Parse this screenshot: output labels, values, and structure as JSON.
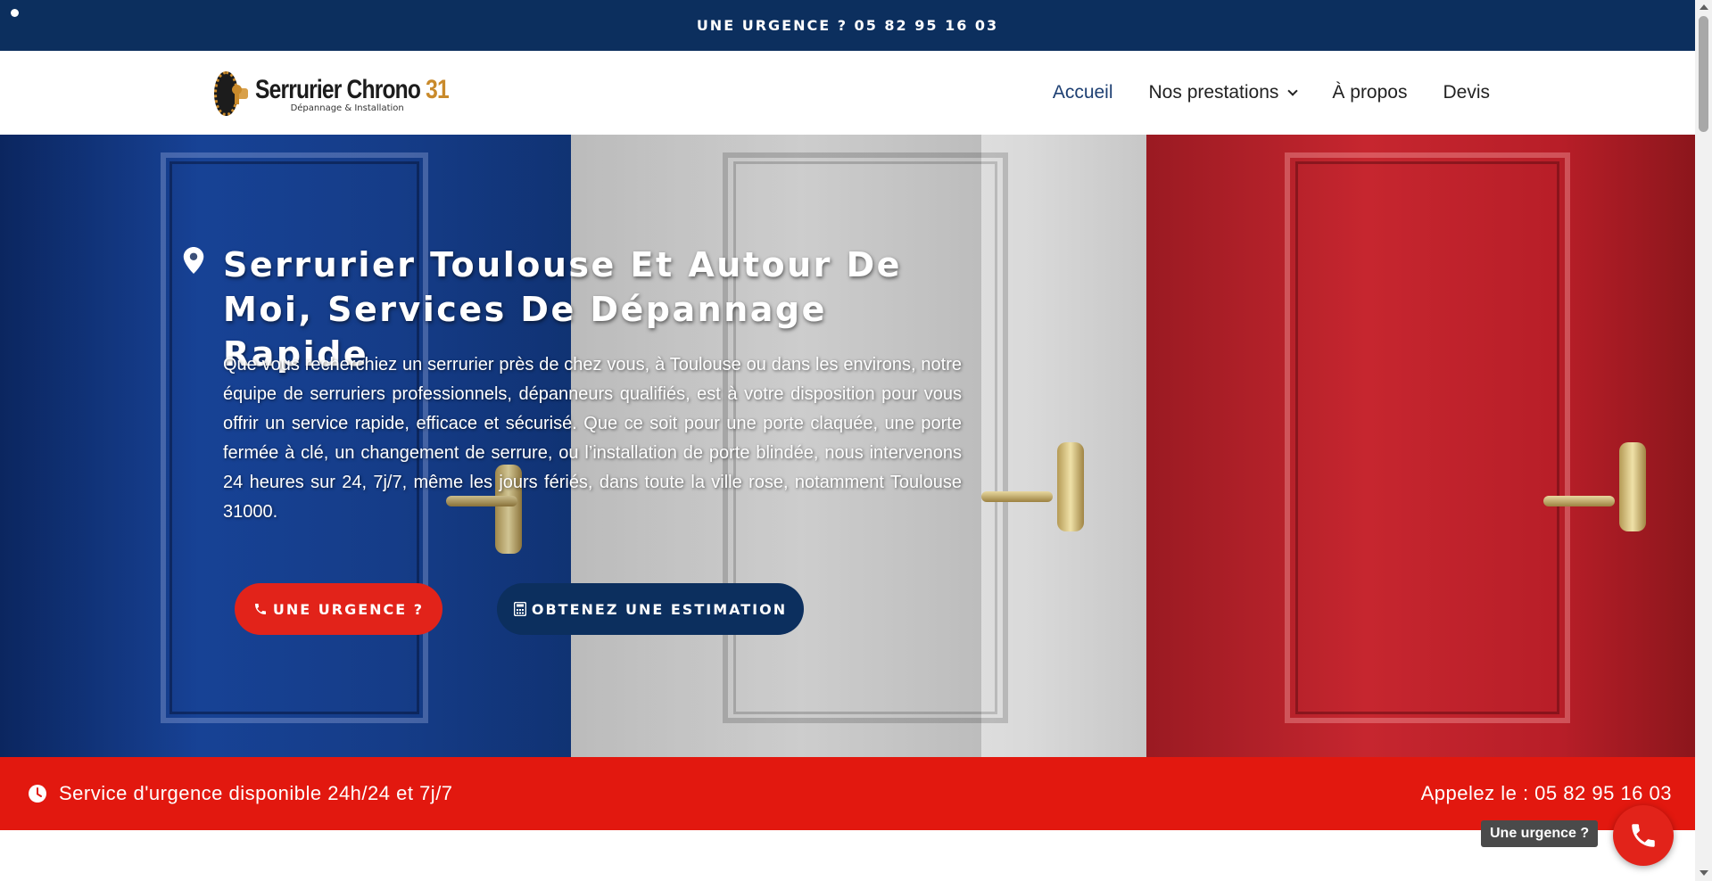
{
  "topbar": {
    "text": "UNE URGENCE ? 05 82 95 16 03"
  },
  "logo": {
    "name": "Serrurier Chrono",
    "number": "31",
    "tagline": "Dépannage & Installation"
  },
  "nav": {
    "items": [
      {
        "label": "Accueil",
        "active": true
      },
      {
        "label": "Nos prestations",
        "has_dropdown": true
      },
      {
        "label": "À propos"
      },
      {
        "label": "Devis"
      }
    ]
  },
  "hero": {
    "title": "Serrurier Toulouse Et Autour De Moi, Services De Dépannage Rapide",
    "text": "Que vous recherchiez un serrurier près de chez vous, à Toulouse ou dans les environs, notre équipe de serruriers professionnels, dépanneurs qualifiés, est à votre disposition pour vous offrir un service rapide, efficace et sécurisé. Que ce soit pour une porte claquée, une porte fermée à clé, un changement de serrure, ou l’installation de porte blindée, nous intervenons 24 heures sur 24, 7j/7, même les jours fériés, dans toute la ville rose, notamment Toulouse 31000.",
    "buttons": {
      "urgent": "UNE URGENCE ?",
      "estimate": "OBTENEZ UNE ESTIMATION"
    }
  },
  "strip": {
    "left": "Service d'urgence disponible 24h/24 et 7j/7",
    "right": "Appelez le : 05 82 95 16 03"
  },
  "floating_call": {
    "label": "Une urgence ?"
  },
  "colors": {
    "navy": "#0c2f5e",
    "red": "#e2231a",
    "strip_red": "#e2180f",
    "gold": "#c98a2b"
  },
  "icons": [
    "map-pin-icon",
    "phone-icon",
    "calculator-icon",
    "clock-icon",
    "chevron-down-icon"
  ]
}
